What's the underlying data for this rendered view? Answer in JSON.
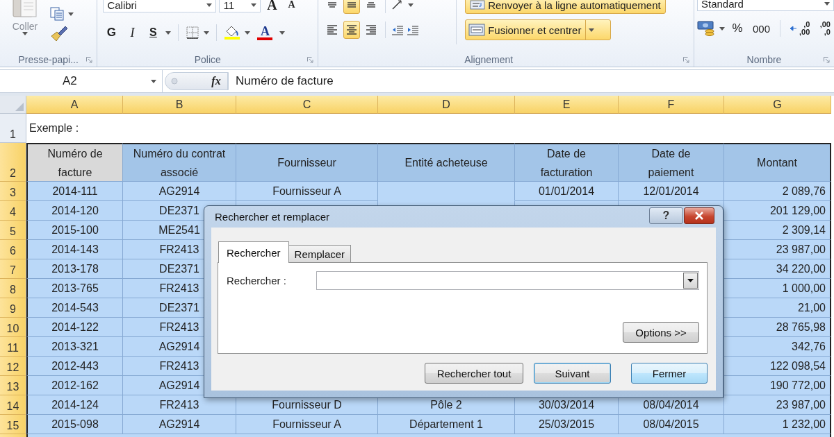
{
  "ribbon": {
    "clipboard": {
      "paste_label": "Coller",
      "group_label": "Presse-papi..."
    },
    "font": {
      "name": "Calibri",
      "size": "11",
      "grow": "A",
      "shrink": "A",
      "bold": "G",
      "italic": "I",
      "underline": "S",
      "color_letter": "A",
      "group_label": "Police"
    },
    "alignment": {
      "top_row": [
        {
          "kind": "top",
          "selected": false
        },
        {
          "kind": "middle",
          "selected": true
        },
        {
          "kind": "bottom",
          "selected": false
        }
      ],
      "bottom_row": [
        {
          "kind": "left",
          "selected": false
        },
        {
          "kind": "center",
          "selected": true
        },
        {
          "kind": "right",
          "selected": false
        }
      ],
      "wrap_text": {
        "label": "Renvoyer à la ligne automatiquement",
        "selected": true
      },
      "merge": {
        "label": "Fusionner et centrer",
        "selected": true
      },
      "group_label": "Alignement"
    },
    "number": {
      "format": "Standard",
      "percent": "%",
      "thousands": "000",
      "increase_decimal": [
        ",0",
        ",00"
      ],
      "decrease_decimal": [
        ",00",
        ",0"
      ],
      "group_label": "Nombre"
    }
  },
  "formula_bar": {
    "name_box": "A2",
    "fx": "fx",
    "value": "Numéro de facture"
  },
  "sheet": {
    "columns": [
      {
        "label": "A",
        "highlighted": true,
        "kind": "text"
      },
      {
        "label": "B",
        "highlighted": true,
        "kind": "text"
      },
      {
        "label": "C",
        "highlighted": true,
        "kind": "text"
      },
      {
        "label": "D",
        "highlighted": true,
        "kind": "text"
      },
      {
        "label": "E",
        "highlighted": true,
        "kind": "text"
      },
      {
        "label": "F",
        "highlighted": true,
        "kind": "text"
      },
      {
        "label": "G",
        "highlighted": true,
        "kind": "amount"
      }
    ],
    "title_row": {
      "label": "1",
      "highlighted": false,
      "text": "Exemple :"
    },
    "header_row": {
      "label": "2",
      "highlighted": true,
      "cells": [
        {
          "text": "Numéro de facture",
          "active": true
        },
        {
          "text": "Numéro du contrat associé",
          "active": false
        },
        {
          "text": "Fournisseur",
          "active": false
        },
        {
          "text": "Entité acheteuse",
          "active": false
        },
        {
          "text": "Date de facturation",
          "active": false
        },
        {
          "text": "Date de paiement",
          "active": false
        },
        {
          "text": "Montant",
          "active": false
        }
      ]
    },
    "rows": [
      {
        "label": "3",
        "highlighted": true,
        "cells": {
          "a": "2014-111",
          "b": "AG2914",
          "c": "Fournisseur A",
          "e": "01/01/2014",
          "f": "12/01/2014",
          "g": "2 089,76"
        },
        "d_merged": true
      },
      {
        "label": "4",
        "highlighted": true,
        "cells": {
          "a": "2014-120",
          "b": "DE2371",
          "g": "201 129,00"
        }
      },
      {
        "label": "5",
        "highlighted": true,
        "cells": {
          "a": "2015-100",
          "b": "ME2541",
          "g": "2 309,14"
        }
      },
      {
        "label": "6",
        "highlighted": true,
        "cells": {
          "a": "2014-143",
          "b": "FR2413",
          "g": "23 987,00"
        }
      },
      {
        "label": "7",
        "highlighted": true,
        "cells": {
          "a": "2013-178",
          "b": "DE2371",
          "g": "34 220,00"
        }
      },
      {
        "label": "8",
        "highlighted": true,
        "cells": {
          "a": "2013-765",
          "b": "FR2413",
          "g": "1 000,00"
        }
      },
      {
        "label": "9",
        "highlighted": true,
        "cells": {
          "a": "2014-543",
          "b": "DE2371",
          "g": "21,00"
        }
      },
      {
        "label": "10",
        "highlighted": true,
        "cells": {
          "a": "2014-122",
          "b": "FR2413",
          "g": "28 765,98"
        }
      },
      {
        "label": "11",
        "highlighted": true,
        "cells": {
          "a": "2013-321",
          "b": "AG2914",
          "g": "342,76"
        }
      },
      {
        "label": "12",
        "highlighted": true,
        "cells": {
          "a": "2012-443",
          "b": "FR2413",
          "g": "122 098,54"
        }
      },
      {
        "label": "13",
        "highlighted": true,
        "cells": {
          "a": "2012-162",
          "b": "AG2914",
          "g": "190 772,00"
        }
      },
      {
        "label": "14",
        "highlighted": true,
        "cells": {
          "a": "2014-124",
          "b": "FR2413",
          "c": "Fournisseur D",
          "d": "Pôle 2",
          "e": "30/03/2014",
          "f": "08/04/2014",
          "g": "23 987,00"
        }
      },
      {
        "label": "15",
        "highlighted": true,
        "cells": {
          "a": "2015-098",
          "b": "AG2914",
          "c": "Fournisseur A",
          "d": "Département 1",
          "e": "25/03/2015",
          "f": "08/04/2015",
          "g": "1 232,00"
        }
      }
    ]
  },
  "dialog": {
    "title": "Rechercher et remplacer",
    "help": "?",
    "tabs": [
      {
        "label": "Rechercher",
        "selected": true
      },
      {
        "label": "Remplacer",
        "selected": false
      }
    ],
    "find_label": "Rechercher :",
    "options_button": "Options >>",
    "buttons": [
      {
        "label": "Rechercher tout",
        "kind": "normal"
      },
      {
        "label": "Suivant",
        "kind": "default"
      },
      {
        "label": "Fermer",
        "kind": "hot"
      }
    ]
  }
}
